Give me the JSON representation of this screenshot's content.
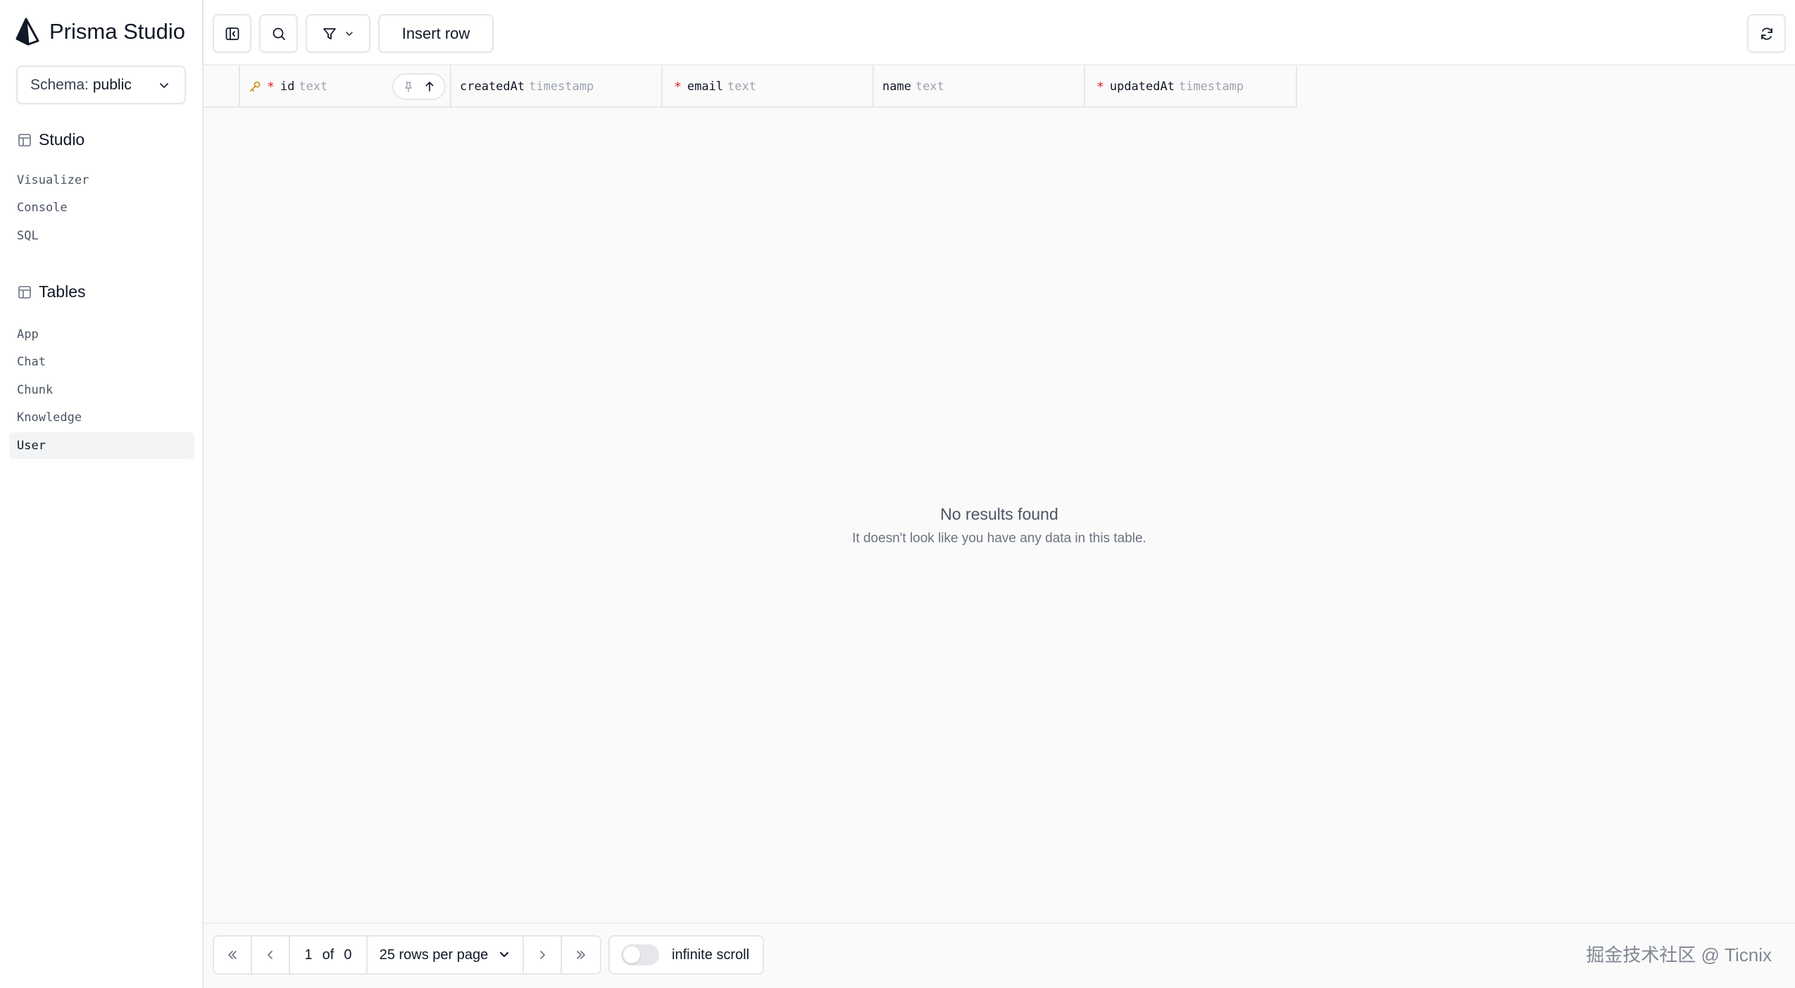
{
  "app": {
    "title": "Prisma Studio"
  },
  "schema": {
    "label": "Schema:",
    "value": "public"
  },
  "sections": {
    "studio": {
      "title": "Studio",
      "items": [
        "Visualizer",
        "Console",
        "SQL"
      ]
    },
    "tables": {
      "title": "Tables",
      "items": [
        "App",
        "Chat",
        "Chunk",
        "Knowledge",
        "User"
      ],
      "active": "User"
    }
  },
  "toolbar": {
    "insert_label": "Insert row"
  },
  "columns": [
    {
      "name": "id",
      "type": "text",
      "required": "*",
      "primary_key": true
    },
    {
      "name": "createdAt",
      "type": "timestamp",
      "required": ""
    },
    {
      "name": "email",
      "type": "text",
      "required": "*"
    },
    {
      "name": "name",
      "type": "text",
      "required": ""
    },
    {
      "name": "updatedAt",
      "type": "timestamp",
      "required": "*"
    }
  ],
  "empty": {
    "title": "No results found",
    "subtitle": "It doesn't look like you have any data in this table."
  },
  "pagination": {
    "page": "1",
    "of_label": "of",
    "total": "0",
    "rows_per_page": "25 rows per page"
  },
  "infinite_scroll": {
    "label": "infinite scroll"
  },
  "watermark": "掘金技术社区 @ Ticnix",
  "colors": {
    "required": "#dc2626",
    "key": "#ca8a04",
    "border": "#e5e7eb"
  }
}
